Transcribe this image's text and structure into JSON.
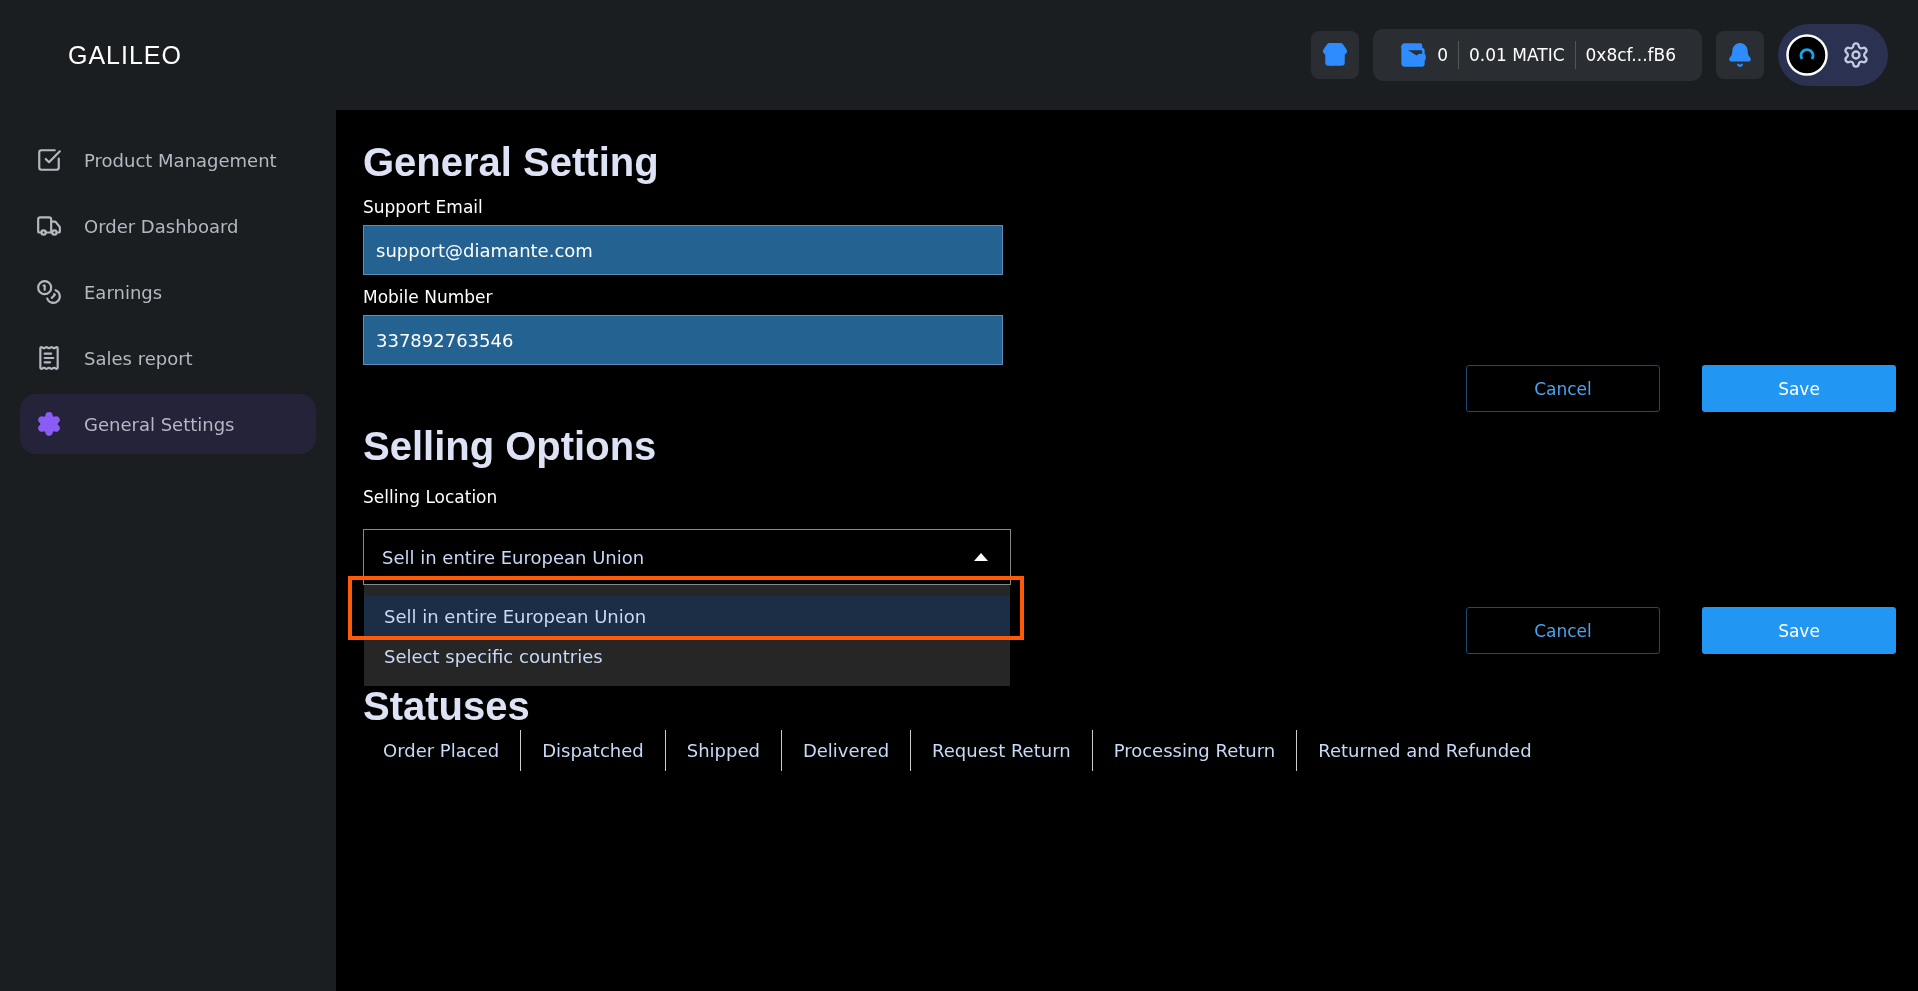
{
  "logo": "GALILEO",
  "header": {
    "wallet": {
      "balance": "0",
      "amount": "0.01 MATIC",
      "address": "0x8cf...fB6"
    }
  },
  "sidebar": {
    "items": [
      {
        "label": "Product Management",
        "selected": false
      },
      {
        "label": "Order Dashboard",
        "selected": false
      },
      {
        "label": "Earnings",
        "selected": false
      },
      {
        "label": "Sales report",
        "selected": false
      },
      {
        "label": "General Settings",
        "selected": true
      }
    ]
  },
  "general": {
    "title": "General Setting",
    "fields": [
      {
        "label": "Support Email",
        "value": "support@diamante.com"
      },
      {
        "label": "Mobile Number",
        "value": "337892763546"
      }
    ],
    "buttons": {
      "cancel": "Cancel",
      "save": "Save"
    }
  },
  "selling": {
    "title": "Selling Options",
    "label": "Selling Location",
    "value": "Sell in entire European Union",
    "expanded": true,
    "options": [
      {
        "label": "Sell in entire European Union",
        "selected": true
      },
      {
        "label": "Select specific countries",
        "selected": false
      }
    ],
    "buttons": {
      "cancel": "Cancel",
      "save": "Save"
    }
  },
  "statuses": {
    "title": "Statuses",
    "tabs": [
      "Order Placed",
      "Dispatched",
      "Shipped",
      "Delivered",
      "Request Return",
      "Processing Return",
      "Returned and Refunded"
    ]
  }
}
